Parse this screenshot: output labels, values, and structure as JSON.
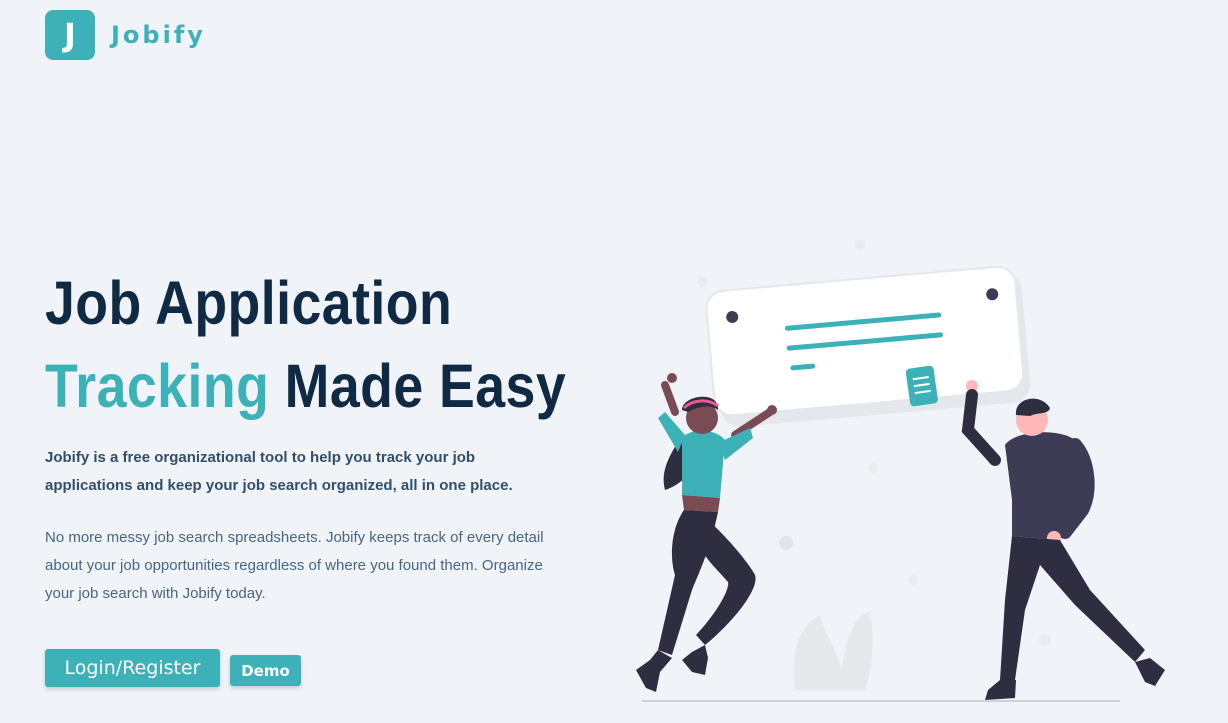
{
  "brand": {
    "logo_letter": "J",
    "name": "Jobify"
  },
  "hero": {
    "title_line1": "Job Application",
    "title_accent": "Tracking",
    "title_rest": "Made Easy",
    "intro": "Jobify is a free organizational tool to help you track your job applications and keep your job search organized, all in one place.",
    "body": "No more messy job search spreadsheets. Jobify keeps track of every detail about your job opportunities regardless of where you found them. Organize your job search with Jobify today."
  },
  "actions": {
    "login_label": "Login/Register",
    "demo_label": "Demo"
  },
  "colors": {
    "primary": "#3cb1b8",
    "heading": "#102a43",
    "background": "#f0f4f8"
  },
  "illustration": {
    "name": "people-holding-job-card-illustration"
  }
}
